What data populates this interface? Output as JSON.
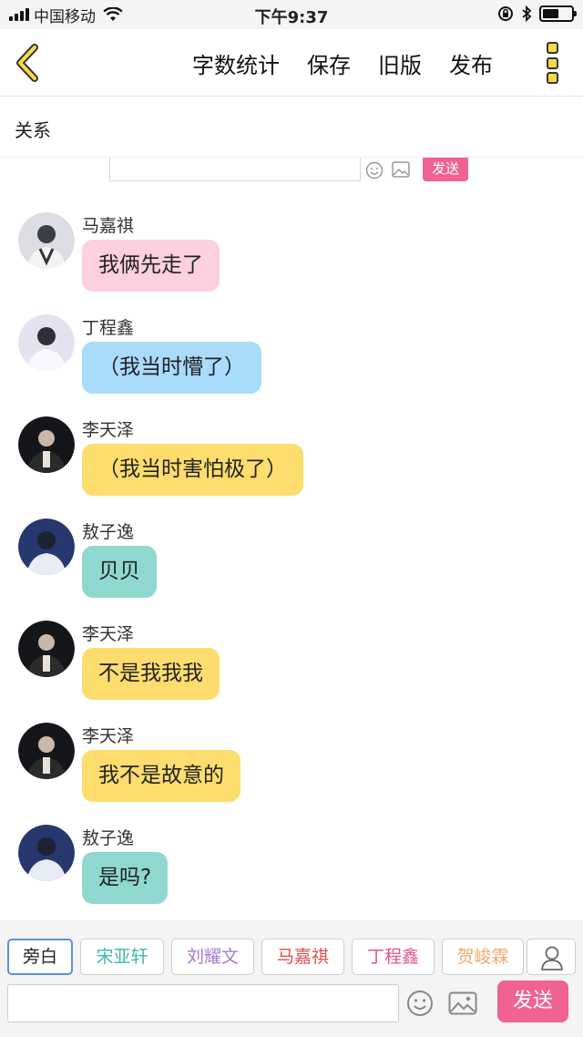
{
  "status_bar": {
    "carrier": "中国移动",
    "time": "下午9:37",
    "battery_level": 0.55
  },
  "nav": {
    "actions": [
      "字数统计",
      "保存",
      "旧版",
      "发布"
    ]
  },
  "section": {
    "title": "关系"
  },
  "mini_send_label": "发送",
  "colors": {
    "pink_bubble": "#fcd0dc",
    "blue_bubble": "#a9dbfb",
    "yellow_bubble": "#fddd6e",
    "teal_bubble": "#8fd8cf",
    "send_button": "#f06292"
  },
  "messages": [
    {
      "name": "马嘉祺",
      "text": "我俩先走了",
      "bubble_color": "#fcd0dc",
      "avatar": "avatar-photo-light"
    },
    {
      "name": "丁程鑫",
      "text": "（我当时懵了）",
      "bubble_color": "#a9dbfb",
      "avatar": "avatar-photo-light"
    },
    {
      "name": "李天泽",
      "text": "（我当时害怕极了）",
      "bubble_color": "#fddd6e",
      "avatar": "avatar-photo-dark"
    },
    {
      "name": "敖子逸",
      "text": "贝贝",
      "bubble_color": "#8fd8cf",
      "avatar": "avatar-photo-blue"
    },
    {
      "name": "李天泽",
      "text": "不是我我我",
      "bubble_color": "#fddd6e",
      "avatar": "avatar-photo-dark"
    },
    {
      "name": "李天泽",
      "text": "我不是故意的",
      "bubble_color": "#fddd6e",
      "avatar": "avatar-photo-dark"
    },
    {
      "name": "敖子逸",
      "text": "是吗?",
      "bubble_color": "#8fd8cf",
      "avatar": "avatar-photo-blue"
    }
  ],
  "roles": [
    {
      "label": "旁白",
      "color": "#222222",
      "active": true
    },
    {
      "label": "宋亚轩",
      "color": "#3fb8a8",
      "active": false
    },
    {
      "label": "刘耀文",
      "color": "#a77ad6",
      "active": false
    },
    {
      "label": "马嘉祺",
      "color": "#d9534f",
      "active": false
    },
    {
      "label": "丁程鑫",
      "color": "#e0568e",
      "active": false
    },
    {
      "label": "贺峻霖",
      "color": "#f0a96b",
      "active": false
    }
  ],
  "composer": {
    "input_value": "",
    "input_placeholder": "",
    "send_label": "发送"
  }
}
